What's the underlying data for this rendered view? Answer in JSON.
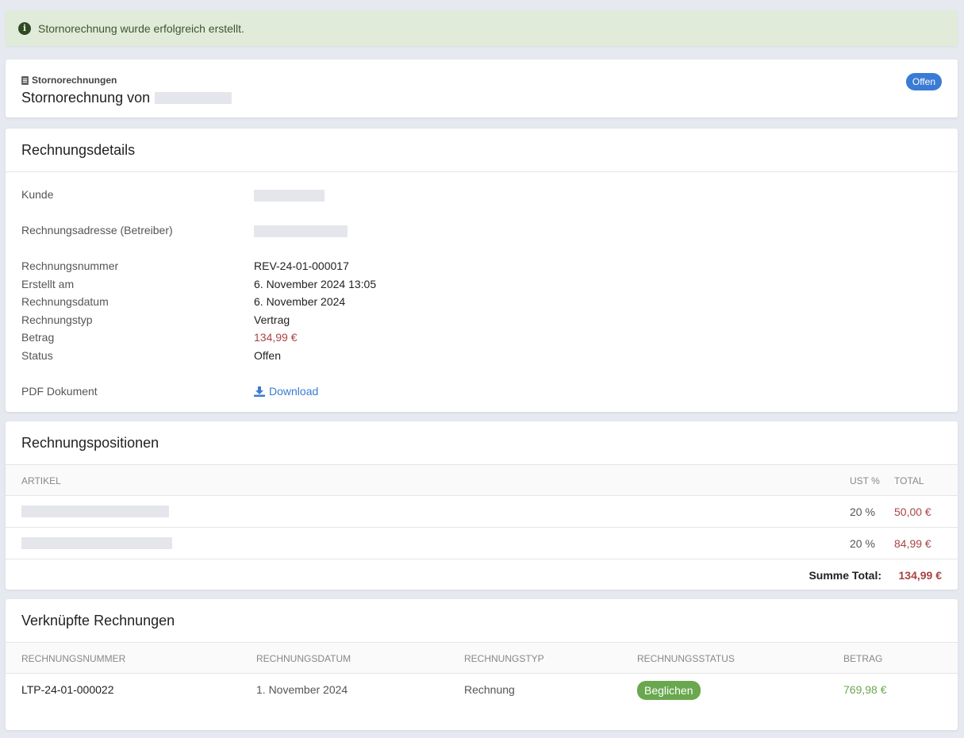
{
  "alert": {
    "icon": "info-icon",
    "message": "Stornorechnung wurde erfolgreich erstellt."
  },
  "header": {
    "kicker": "Stornorechnungen",
    "title": "Stornorechnung von",
    "status_badge": "Offen"
  },
  "details": {
    "card_title": "Rechnungsdetails",
    "rows": {
      "kunde": {
        "label": "Kunde"
      },
      "adresse": {
        "label": "Rechnungsadresse (Betreiber)"
      },
      "nummer": {
        "label": "Rechnungsnummer",
        "value": "REV-24-01-000017"
      },
      "erstellt": {
        "label": "Erstellt am",
        "value": "6. November 2024 13:05"
      },
      "datum": {
        "label": "Rechnungsdatum",
        "value": "6. November 2024"
      },
      "typ": {
        "label": "Rechnungstyp",
        "value": "Vertrag"
      },
      "betrag": {
        "label": "Betrag",
        "value": "134,99 €"
      },
      "status": {
        "label": "Status",
        "value": "Offen"
      },
      "pdf": {
        "label": "PDF Dokument",
        "value": "Download",
        "icon": "download-icon"
      }
    }
  },
  "positions": {
    "card_title": "Rechnungspositionen",
    "columns": {
      "artikel": "ARTIKEL",
      "ust": "UST %",
      "total": "TOTAL"
    },
    "items": [
      {
        "ust": "20 %",
        "total": "50,00 €"
      },
      {
        "ust": "20 %",
        "total": "84,99 €"
      }
    ],
    "sum_label": "Summe Total:",
    "sum_value": "134,99 €"
  },
  "linked": {
    "card_title": "Verknüpfte Rechnungen",
    "columns": {
      "nummer": "RECHNUNGSNUMMER",
      "datum": "RECHNUNGSDATUM",
      "typ": "RECHNUNGSTYP",
      "status": "RECHNUNGSSTATUS",
      "betrag": "BETRAG"
    },
    "rows": [
      {
        "nummer": "LTP-24-01-000022",
        "datum": "1. November 2024",
        "typ": "Rechnung",
        "status": "Beglichen",
        "betrag": "769,98 €"
      }
    ]
  },
  "colors": {
    "accent": "#3a7bd5",
    "money": "#a94442",
    "paid": "#6aa84f",
    "success_bg": "#e1ebda"
  }
}
